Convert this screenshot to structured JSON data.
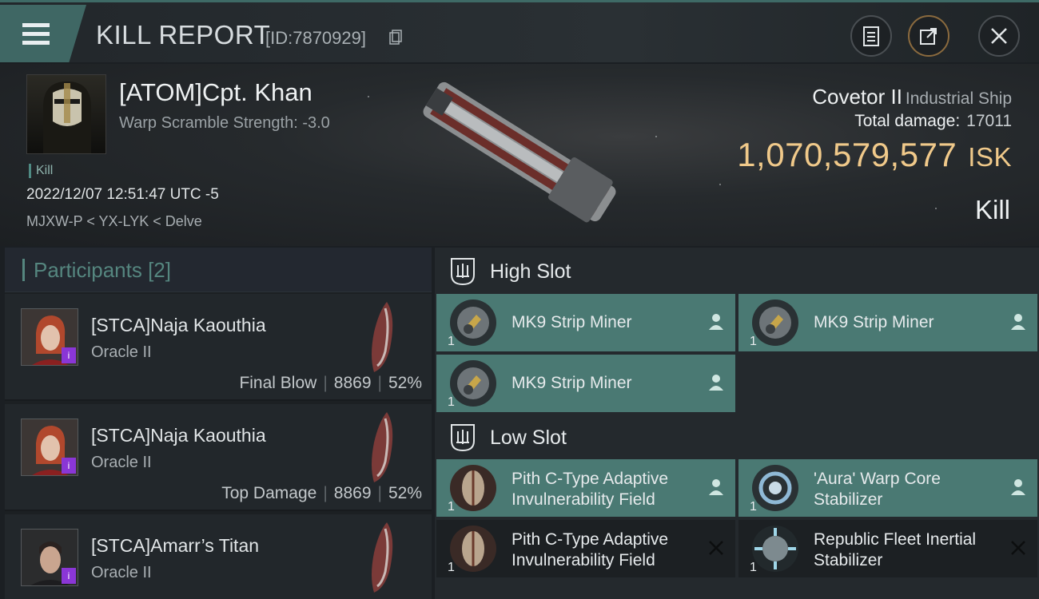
{
  "header": {
    "title": "KILL REPORT",
    "id_label": "[ID:7870929]"
  },
  "victim": {
    "name": "[ATOM]Cpt. Khan",
    "scram": "Warp Scramble Strength: -3.0",
    "kill_tag": "Kill",
    "time": "2022/12/07 12:51:47 UTC -5",
    "location": "MJXW-P < YX-LYK < Delve",
    "ship": "Covetor II",
    "ship_class": "Industrial Ship",
    "total_damage_label": "Total damage:",
    "total_damage": "17011",
    "isk_value": "1,070,579,577",
    "isk_unit": "ISK",
    "result": "Kill"
  },
  "participants": {
    "title": "Participants [2]",
    "rows": [
      {
        "name": "[STCA]Naja Kaouthia",
        "ship": "Oracle II",
        "role": "Final Blow",
        "damage": "8869",
        "pct": "52%"
      },
      {
        "name": "[STCA]Naja Kaouthia",
        "ship": "Oracle II",
        "role": "Top Damage",
        "damage": "8869",
        "pct": "52%"
      },
      {
        "name": "[STCA]Amarr’s Titan",
        "ship": "Oracle II",
        "role": "",
        "damage": "",
        "pct": ""
      }
    ]
  },
  "fitting": {
    "high_slot_label": "High Slot",
    "low_slot_label": "Low Slot",
    "high": [
      {
        "name": "MK9 Strip Miner",
        "qty": "1",
        "state": "dropped"
      },
      {
        "name": "MK9 Strip Miner",
        "qty": "1",
        "state": "dropped"
      },
      {
        "name": "MK9 Strip Miner",
        "qty": "1",
        "state": "dropped"
      }
    ],
    "low": [
      {
        "name_l1": "Pith C-Type Adaptive",
        "name_l2": "Invulnerability Field",
        "qty": "1",
        "state": "dropped"
      },
      {
        "name_l1": "'Aura' Warp Core",
        "name_l2": "Stabilizer",
        "qty": "1",
        "state": "dropped"
      },
      {
        "name_l1": "Pith C-Type Adaptive",
        "name_l2": "Invulnerability Field",
        "qty": "1",
        "state": "destroyed"
      },
      {
        "name_l1": "Republic Fleet Inertial",
        "name_l2": "Stabilizer",
        "qty": "1",
        "state": "destroyed"
      }
    ]
  },
  "colors": {
    "accent_teal": "#4a7973",
    "isk_gold": "#f0c98a",
    "badge_purple": "#8a36d6"
  },
  "icons": [
    "menu-icon",
    "copy-icon",
    "clipboard-icon",
    "share-icon",
    "close-icon",
    "slot-high-icon",
    "slot-low-icon",
    "pilot-icon",
    "destroyed-x-icon"
  ]
}
